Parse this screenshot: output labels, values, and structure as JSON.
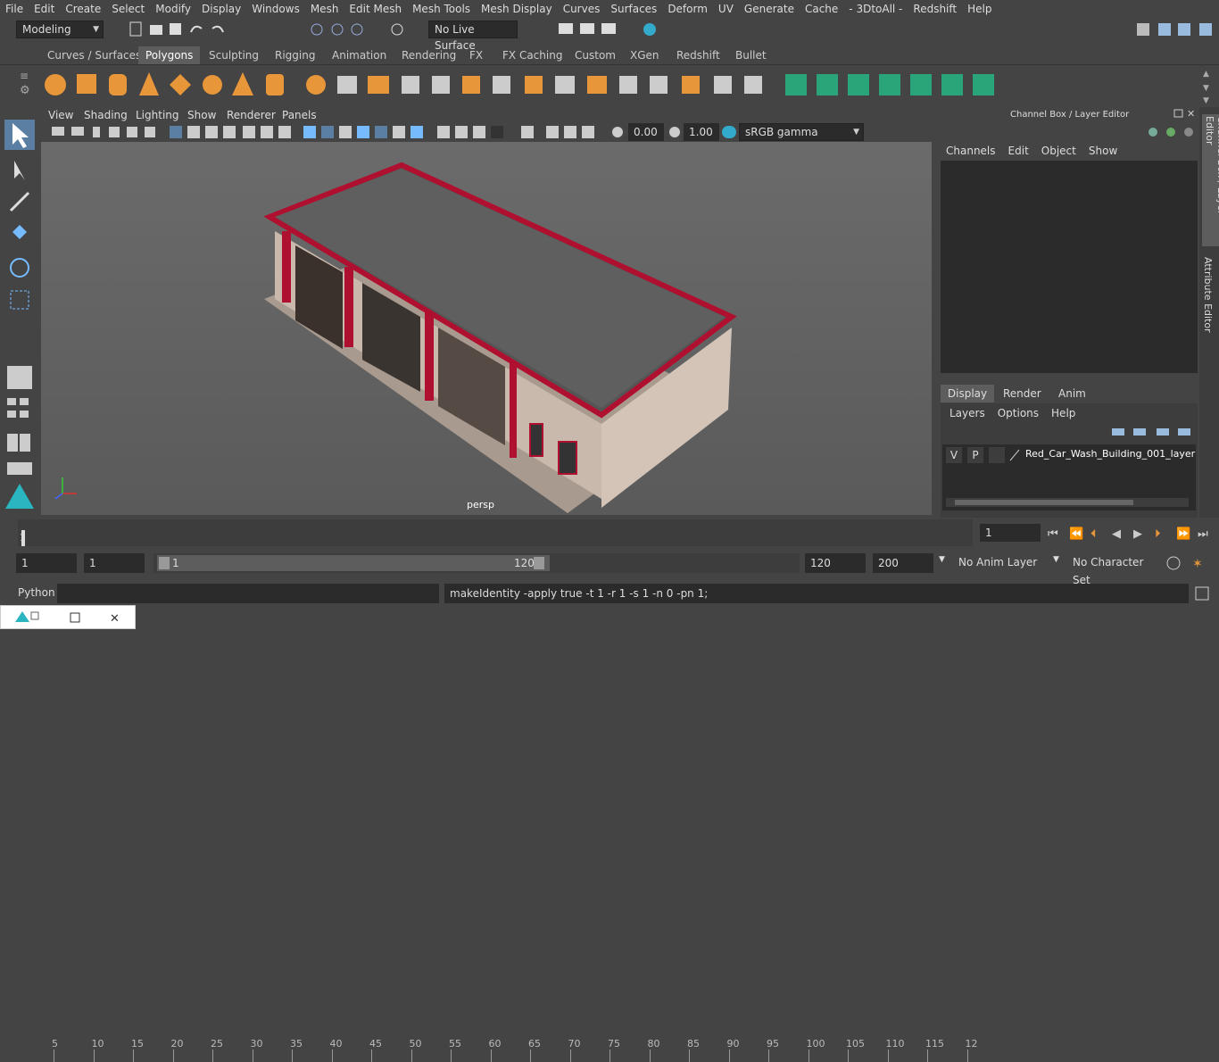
{
  "menubar": [
    "File",
    "Edit",
    "Create",
    "Select",
    "Modify",
    "Display",
    "Windows",
    "Mesh",
    "Edit Mesh",
    "Mesh Tools",
    "Mesh Display",
    "Curves",
    "Surfaces",
    "Deform",
    "UV",
    "Generate",
    "Cache",
    "- 3DtoAll -",
    "Redshift",
    "Help"
  ],
  "status": {
    "mode": "Modeling",
    "live_surface": "No Live Surface"
  },
  "shelf_tabs": [
    "Curves / Surfaces",
    "Polygons",
    "Sculpting",
    "Rigging",
    "Animation",
    "Rendering",
    "FX",
    "FX Caching",
    "Custom",
    "XGen",
    "Redshift",
    "Bullet"
  ],
  "shelf_active": "Polygons",
  "viewport": {
    "menu": [
      "View",
      "Shading",
      "Lighting",
      "Show",
      "Renderer",
      "Panels"
    ],
    "exposure": "0.00",
    "gamma": "1.00",
    "color_space": "sRGB gamma",
    "camera_label": "persp"
  },
  "channel_box": {
    "title": "Channel Box / Layer Editor",
    "menu": [
      "Channels",
      "Edit",
      "Object",
      "Show"
    ],
    "layer_tabs": [
      "Display",
      "Render",
      "Anim"
    ],
    "layer_menu": [
      "Layers",
      "Options",
      "Help"
    ],
    "layer": {
      "v": "V",
      "p": "P",
      "name": "Red_Car_Wash_Building_001_layer"
    }
  },
  "side_tabs": [
    "Channel Box / Layer Editor",
    "Attribute Editor"
  ],
  "timeline": {
    "ticks": [
      "5",
      "10",
      "15",
      "20",
      "25",
      "30",
      "35",
      "40",
      "45",
      "50",
      "55",
      "60",
      "65",
      "70",
      "75",
      "80",
      "85",
      "90",
      "95",
      "100",
      "105",
      "110",
      "115",
      "12"
    ],
    "start_label": "1",
    "current_frame": "1"
  },
  "range": {
    "start": "1",
    "playback_start": "1",
    "slider_start": "1",
    "slider_end": "120",
    "end": "120",
    "anim_end": "200",
    "anim_layer": "No Anim Layer",
    "char_set": "No Character Set"
  },
  "cmdline": {
    "lang": "Python",
    "output": "makeIdentity -apply true -t 1 -r 1 -s 1 -n 0 -pn 1;"
  },
  "colors": {
    "accent": "#5d5d5d",
    "building_red": "#b01030",
    "shelf_green": "#2aa57a",
    "shelf_orange": "#e8963a"
  }
}
